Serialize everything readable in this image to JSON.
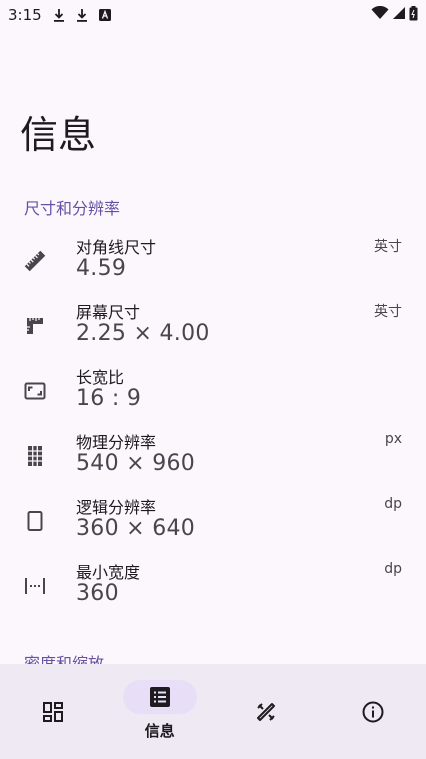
{
  "status_bar": {
    "time": "3:15",
    "icons": [
      "download-icon",
      "download-icon",
      "a-badge-icon",
      "wifi-icon",
      "signal-icon",
      "battery-icon"
    ]
  },
  "page": {
    "title": "信息"
  },
  "sections": [
    {
      "title": "尺寸和分辨率"
    },
    {
      "title": "密度和缩放"
    }
  ],
  "rows": [
    {
      "icon": "ruler-diagonal-icon",
      "label": "对角线尺寸",
      "value": "4.59",
      "unit": "英寸"
    },
    {
      "icon": "ruler-square-icon",
      "label": "屏幕尺寸",
      "value": "2.25 × 4.00",
      "unit": "英寸"
    },
    {
      "icon": "aspect-ratio-icon",
      "label": "长宽比",
      "value": "16 : 9",
      "unit": ""
    },
    {
      "icon": "grid-icon",
      "label": "物理分辨率",
      "value": "540 × 960",
      "unit": "px"
    },
    {
      "icon": "rectangle-icon",
      "label": "逻辑分辨率",
      "value": "360 × 640",
      "unit": "dp"
    },
    {
      "icon": "width-icon",
      "label": "最小宽度",
      "value": "360",
      "unit": "dp"
    }
  ],
  "bottom_nav": {
    "items": [
      {
        "icon": "dashboard-icon",
        "label": ""
      },
      {
        "icon": "list-icon",
        "label": "信息"
      },
      {
        "icon": "tools-icon",
        "label": ""
      },
      {
        "icon": "info-icon",
        "label": ""
      }
    ],
    "active_index": 1
  },
  "colors": {
    "background": "#fcf7fd",
    "accent": "#6750a4",
    "nav_background": "#efe9f3",
    "nav_active_pill": "#e8def8"
  }
}
